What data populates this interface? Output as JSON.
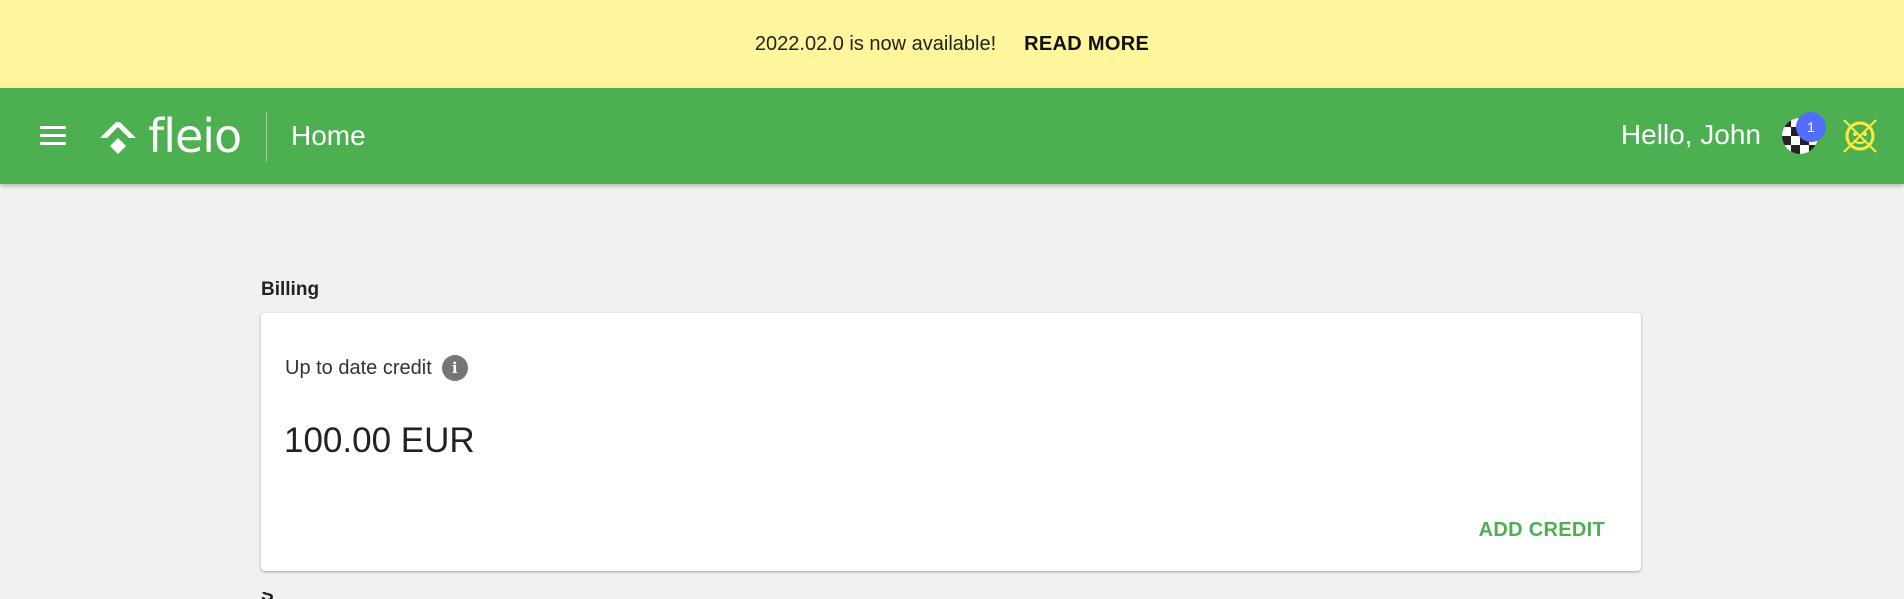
{
  "announcement": {
    "message": "2022.02.0 is now available!",
    "link_label": "READ MORE"
  },
  "header": {
    "logo_text": "fleio",
    "page_title": "Home",
    "greeting": "Hello, John",
    "notification_count": "1",
    "icons": {
      "menu": "menu-icon",
      "logo": "fleio-logo-icon",
      "avatar": "user-avatar-icon",
      "secondary_avatar": "user-avatar-icon"
    }
  },
  "billing": {
    "section_title": "Billing",
    "credit_label": "Up to date credit",
    "credit_value": "100.00 EUR",
    "add_credit_label": "ADD CREDIT",
    "info_icon": "info-icon"
  },
  "colors": {
    "announcement_bg": "#fff59d",
    "header_bg": "#4caf50",
    "badge_bg": "#536dfe",
    "accent": "#4caf50",
    "page_bg": "#f1f1f1"
  }
}
